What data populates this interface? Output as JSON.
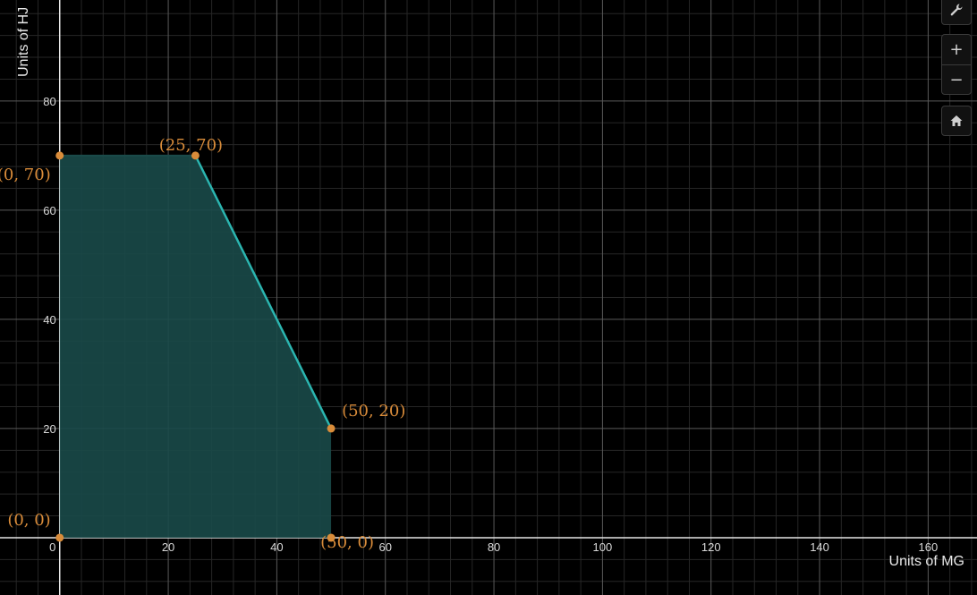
{
  "chart_data": {
    "type": "area",
    "xlabel": "Units of MG",
    "ylabel": "Units of HJ",
    "xlim": [
      -11,
      169
    ],
    "ylim": [
      -10.5,
      98.5
    ],
    "x_ticks": [
      0,
      20,
      40,
      60,
      80,
      100,
      120,
      140,
      160
    ],
    "y_ticks": [
      20,
      40,
      60,
      80
    ],
    "grid": true,
    "region": {
      "vertices": [
        [
          0,
          0
        ],
        [
          0,
          70
        ],
        [
          25,
          70
        ],
        [
          50,
          20
        ],
        [
          50,
          0
        ]
      ],
      "fill_color": "#1a4a49",
      "boundary_color": "#2bb5b0"
    },
    "points": [
      {
        "x": 0,
        "y": 70,
        "label": "(0, 70)"
      },
      {
        "x": 25,
        "y": 70,
        "label": "(25, 70)"
      },
      {
        "x": 50,
        "y": 20,
        "label": "(50, 20)"
      },
      {
        "x": 0,
        "y": 0,
        "label": "(0, 0)"
      },
      {
        "x": 50,
        "y": 0,
        "label": "(50, 0)"
      }
    ],
    "point_color": "#d98c3a"
  },
  "toolbar": {
    "settings_icon": "wrench-icon",
    "zoom_in_label": "+",
    "zoom_out_label": "−",
    "home_icon": "home-icon"
  }
}
